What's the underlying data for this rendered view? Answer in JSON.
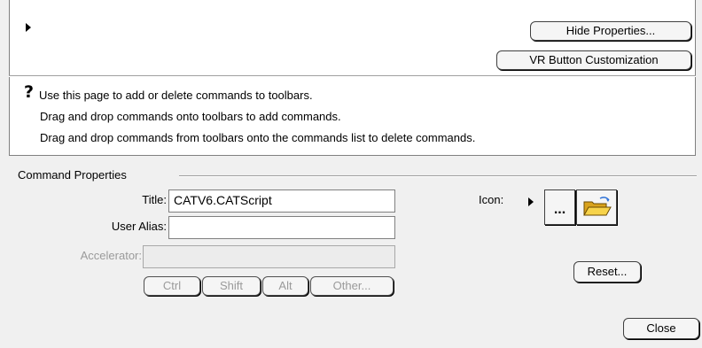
{
  "top": {
    "hide_properties_label": "Hide Properties...",
    "vr_button_label": "VR Button Customization"
  },
  "help": {
    "icon": "question-mark-icon",
    "line1": "Use this page to add or delete commands to toolbars.",
    "line2": "Drag and drop commands onto toolbars to add commands.",
    "line3": "Drag and drop commands from toolbars onto the commands list to delete commands."
  },
  "command_properties": {
    "group_label": "Command Properties",
    "title_label": "Title:",
    "title_value": "CATV6.CATScript",
    "alias_label": "User Alias:",
    "alias_value": "",
    "accelerator_label": "Accelerator:",
    "accelerator_value": "",
    "modifiers": [
      "Ctrl",
      "Shift",
      "Alt",
      "Other..."
    ],
    "icon_label": "Icon:",
    "icon_dots_label": "...",
    "reset_label": "Reset..."
  },
  "footer": {
    "close_label": "Close"
  }
}
